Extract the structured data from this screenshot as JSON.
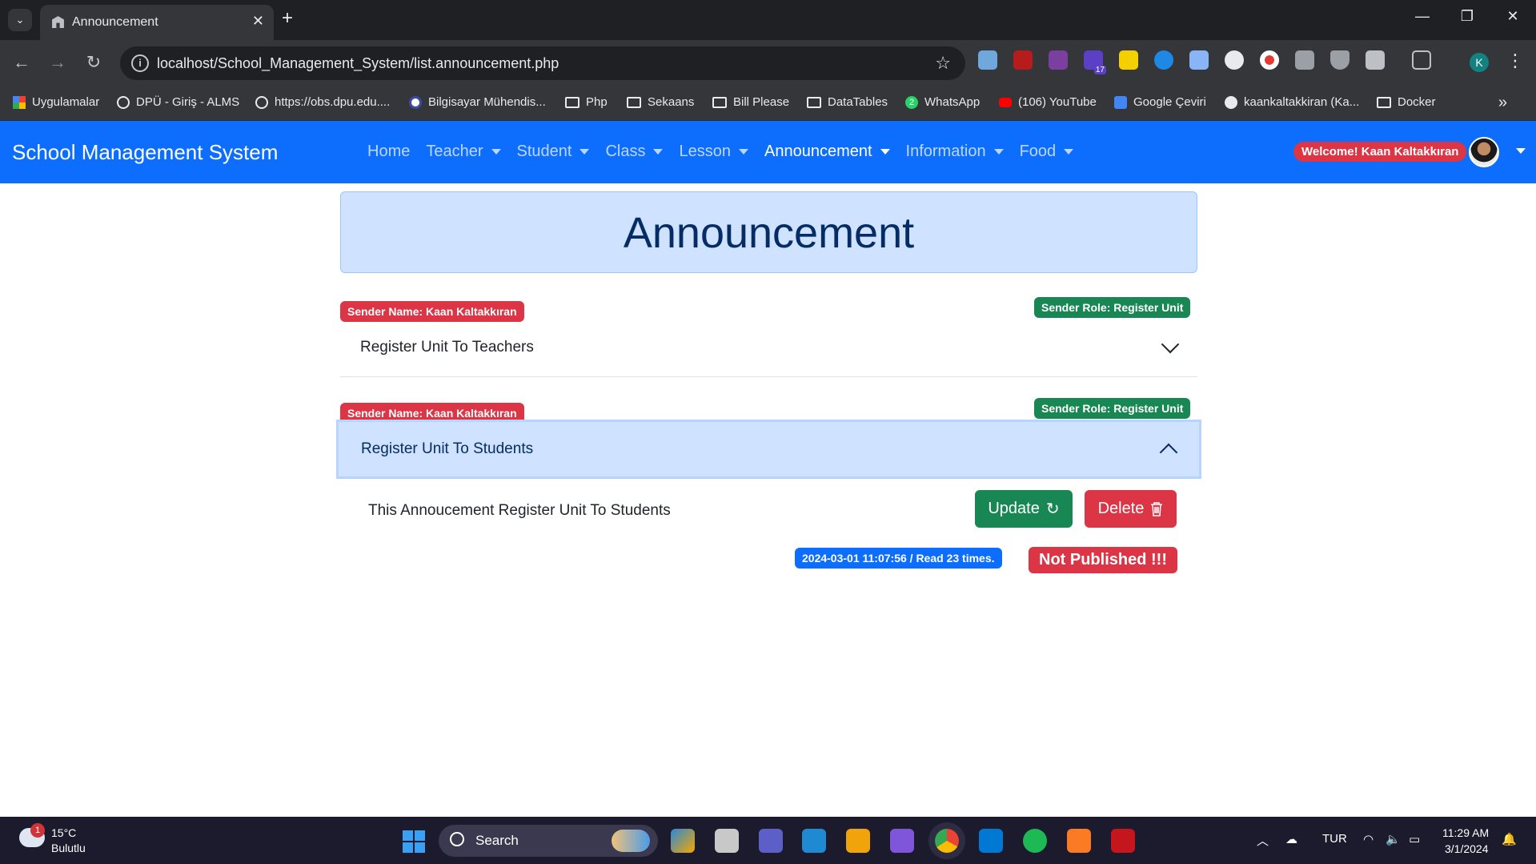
{
  "browser": {
    "tab_title": "Announcement",
    "url": "localhost/School_Management_System/list.announcement.php",
    "bookmarks": [
      "Uygulamalar",
      "DPÜ - Giriş - ALMS",
      "https://obs.dpu.edu....",
      "Bilgisayar Mühendis...",
      "Php",
      "Sekaans",
      "Bill Please",
      "DataTables",
      "WhatsApp",
      "(106) YouTube",
      "Google Çeviri",
      "kaankaltakkiran (Ka...",
      "Docker"
    ],
    "whatsapp_count": "2",
    "extension_badge": "17",
    "profile_initial": "K"
  },
  "navbar": {
    "brand": "School Management System",
    "links": [
      "Home",
      "Teacher",
      "Student",
      "Class",
      "Lesson",
      "Announcement",
      "Information",
      "Food"
    ],
    "active_link": "Announcement",
    "welcome": "Welcome! Kaan Kaltakkıran"
  },
  "page": {
    "heading": "Announcement",
    "announcements": [
      {
        "sender_name": "Sender Name: Kaan Kaltakkıran",
        "sender_role": "Sender Role: Register Unit",
        "title": "Register Unit To Teachers",
        "expanded": false
      },
      {
        "sender_name": "Sender Name: Kaan Kaltakkıran",
        "sender_role": "Sender Role: Register Unit",
        "title": "Register Unit To Students",
        "expanded": true,
        "body": "This Annoucement Register Unit To Students",
        "update_label": "Update",
        "delete_label": "Delete",
        "meta": "2024-03-01 11:07:56 / Read 23 times.",
        "status": "Not Published !!!"
      }
    ]
  },
  "taskbar": {
    "weather_temp": "15°C",
    "weather_desc": "Bulutlu",
    "weather_badge": "1",
    "search_label": "Search",
    "language": "TUR",
    "time": "11:29 AM",
    "date": "3/1/2024"
  },
  "colors": {
    "primary": "#0d6efd",
    "danger": "#dc3545",
    "success": "#198754",
    "accordion_active": "#cfe2ff"
  }
}
